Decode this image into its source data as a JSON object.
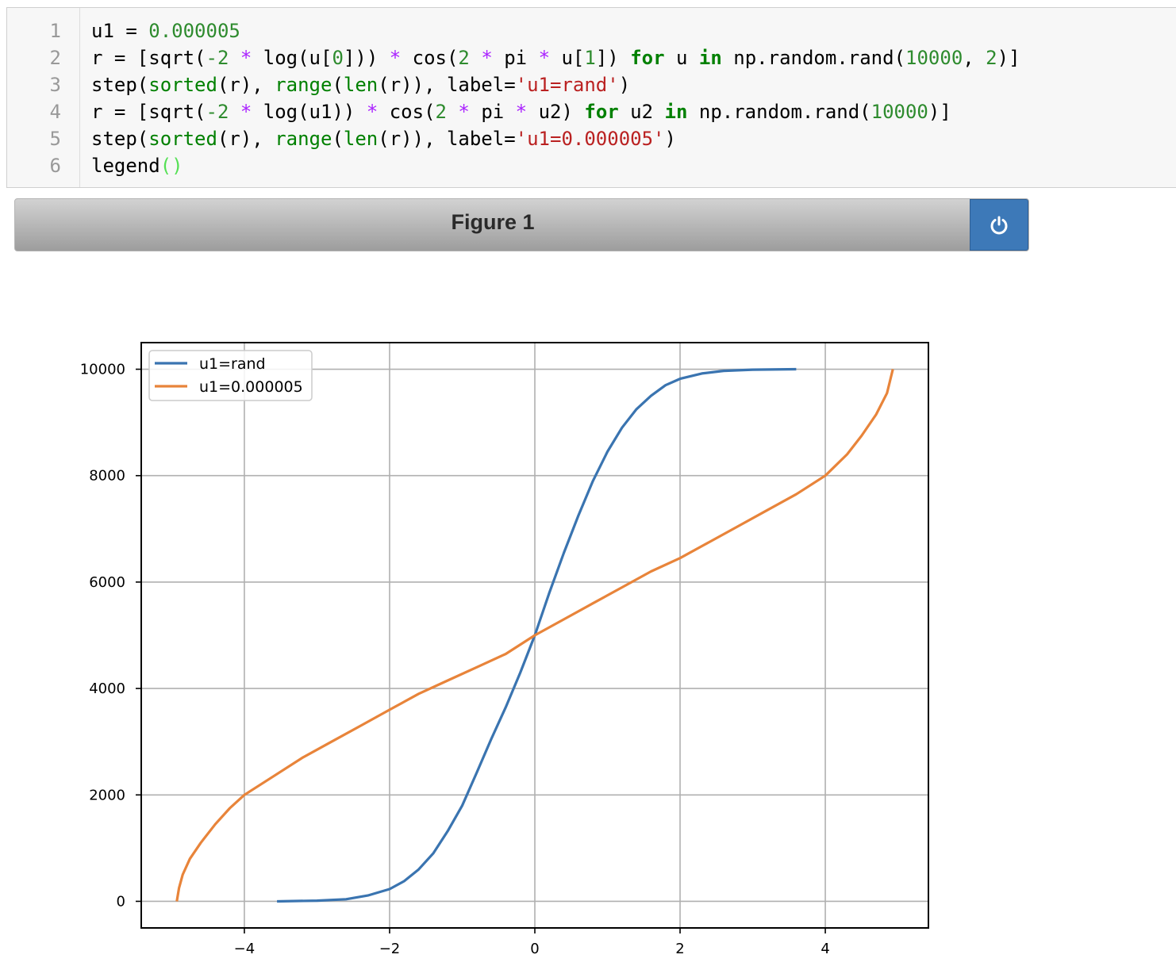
{
  "code_cell": {
    "line_numbers": [
      "1",
      "2",
      "3",
      "4",
      "5",
      "6"
    ],
    "lines": [
      [
        [
          "u1 = ",
          ""
        ],
        [
          "0.000005",
          "num"
        ]
      ],
      [
        [
          "r = [sqrt(",
          ""
        ],
        [
          "-2",
          "num"
        ],
        [
          " ",
          ""
        ],
        [
          "*",
          "op"
        ],
        [
          " log(u[",
          ""
        ],
        [
          "0",
          "num"
        ],
        [
          "])) ",
          ""
        ],
        [
          "*",
          "op"
        ],
        [
          " cos(",
          ""
        ],
        [
          "2",
          "num"
        ],
        [
          " ",
          ""
        ],
        [
          "*",
          "op"
        ],
        [
          " pi ",
          ""
        ],
        [
          "*",
          "op"
        ],
        [
          " u[",
          ""
        ],
        [
          "1",
          "num"
        ],
        [
          "]) ",
          ""
        ],
        [
          "for",
          "kw"
        ],
        [
          " u ",
          ""
        ],
        [
          "in",
          "kw"
        ],
        [
          " np.random.rand(",
          ""
        ],
        [
          "10000",
          "num"
        ],
        [
          ", ",
          ""
        ],
        [
          "2",
          "num"
        ],
        [
          ")]",
          ""
        ]
      ],
      [
        [
          "step(",
          ""
        ],
        [
          "sorted",
          "bi"
        ],
        [
          "(r), ",
          ""
        ],
        [
          "range",
          "bi"
        ],
        [
          "(",
          ""
        ],
        [
          "len",
          "bi"
        ],
        [
          "(r)), label=",
          ""
        ],
        [
          "'u1=rand'",
          "str"
        ],
        [
          ")",
          ""
        ]
      ],
      [
        [
          "r = [sqrt(",
          ""
        ],
        [
          "-2",
          "num"
        ],
        [
          " ",
          ""
        ],
        [
          "*",
          "op"
        ],
        [
          " log(u1)) ",
          ""
        ],
        [
          "*",
          "op"
        ],
        [
          " cos(",
          ""
        ],
        [
          "2",
          "num"
        ],
        [
          " ",
          ""
        ],
        [
          "*",
          "op"
        ],
        [
          " pi ",
          ""
        ],
        [
          "*",
          "op"
        ],
        [
          " u2) ",
          ""
        ],
        [
          "for",
          "kw"
        ],
        [
          " u2 ",
          ""
        ],
        [
          "in",
          "kw"
        ],
        [
          " np.random.rand(",
          ""
        ],
        [
          "10000",
          "num"
        ],
        [
          ")]",
          ""
        ]
      ],
      [
        [
          "step(",
          ""
        ],
        [
          "sorted",
          "bi"
        ],
        [
          "(r), ",
          ""
        ],
        [
          "range",
          "bi"
        ],
        [
          "(",
          ""
        ],
        [
          "len",
          "bi"
        ],
        [
          "(r)), label=",
          ""
        ],
        [
          "'u1=0.000005'",
          "str"
        ],
        [
          ")",
          ""
        ]
      ],
      [
        [
          "legend",
          ""
        ],
        [
          "()",
          "paren"
        ]
      ]
    ]
  },
  "figure": {
    "title": "Figure 1",
    "power_icon": "power-icon"
  },
  "chart_data": {
    "type": "line",
    "title": "",
    "xlabel": "",
    "ylabel": "",
    "xlim": [
      -5.42,
      5.42
    ],
    "ylim": [
      -500,
      10500
    ],
    "x_ticks": [
      -4,
      -2,
      0,
      2,
      4
    ],
    "x_tick_labels": [
      "−4",
      "−2",
      "0",
      "2",
      "4"
    ],
    "y_ticks": [
      0,
      2000,
      4000,
      6000,
      8000,
      10000
    ],
    "y_tick_labels": [
      "0",
      "2000",
      "4000",
      "6000",
      "8000",
      "10000"
    ],
    "grid": true,
    "legend_position": "top-left",
    "series": [
      {
        "name": "u1=rand",
        "color": "#3a74b0",
        "points": [
          [
            -3.55,
            0
          ],
          [
            -3.0,
            12
          ],
          [
            -2.6,
            40
          ],
          [
            -2.3,
            110
          ],
          [
            -2.0,
            230
          ],
          [
            -1.8,
            380
          ],
          [
            -1.6,
            600
          ],
          [
            -1.4,
            900
          ],
          [
            -1.2,
            1320
          ],
          [
            -1.0,
            1800
          ],
          [
            -0.8,
            2420
          ],
          [
            -0.6,
            3050
          ],
          [
            -0.4,
            3650
          ],
          [
            -0.2,
            4300
          ],
          [
            0.0,
            5000
          ],
          [
            0.2,
            5800
          ],
          [
            0.4,
            6550
          ],
          [
            0.6,
            7250
          ],
          [
            0.8,
            7900
          ],
          [
            1.0,
            8450
          ],
          [
            1.2,
            8900
          ],
          [
            1.4,
            9250
          ],
          [
            1.6,
            9500
          ],
          [
            1.8,
            9700
          ],
          [
            2.0,
            9820
          ],
          [
            2.3,
            9920
          ],
          [
            2.6,
            9970
          ],
          [
            3.0,
            9992
          ],
          [
            3.6,
            10000
          ]
        ]
      },
      {
        "name": "u1=0.000005",
        "color": "#e8843a",
        "points": [
          [
            -4.93,
            0
          ],
          [
            -4.9,
            250
          ],
          [
            -4.85,
            500
          ],
          [
            -4.75,
            800
          ],
          [
            -4.6,
            1100
          ],
          [
            -4.4,
            1450
          ],
          [
            -4.2,
            1750
          ],
          [
            -4.0,
            2000
          ],
          [
            -3.6,
            2350
          ],
          [
            -3.2,
            2700
          ],
          [
            -2.8,
            3000
          ],
          [
            -2.4,
            3300
          ],
          [
            -2.0,
            3600
          ],
          [
            -1.6,
            3900
          ],
          [
            -1.2,
            4150
          ],
          [
            -0.8,
            4400
          ],
          [
            -0.4,
            4650
          ],
          [
            0.0,
            5000
          ],
          [
            0.4,
            5300
          ],
          [
            0.8,
            5600
          ],
          [
            1.2,
            5900
          ],
          [
            1.6,
            6200
          ],
          [
            2.0,
            6450
          ],
          [
            2.4,
            6750
          ],
          [
            2.8,
            7050
          ],
          [
            3.2,
            7350
          ],
          [
            3.6,
            7650
          ],
          [
            4.0,
            8000
          ],
          [
            4.3,
            8400
          ],
          [
            4.5,
            8750
          ],
          [
            4.7,
            9150
          ],
          [
            4.85,
            9550
          ],
          [
            4.93,
            10000
          ]
        ]
      }
    ]
  }
}
